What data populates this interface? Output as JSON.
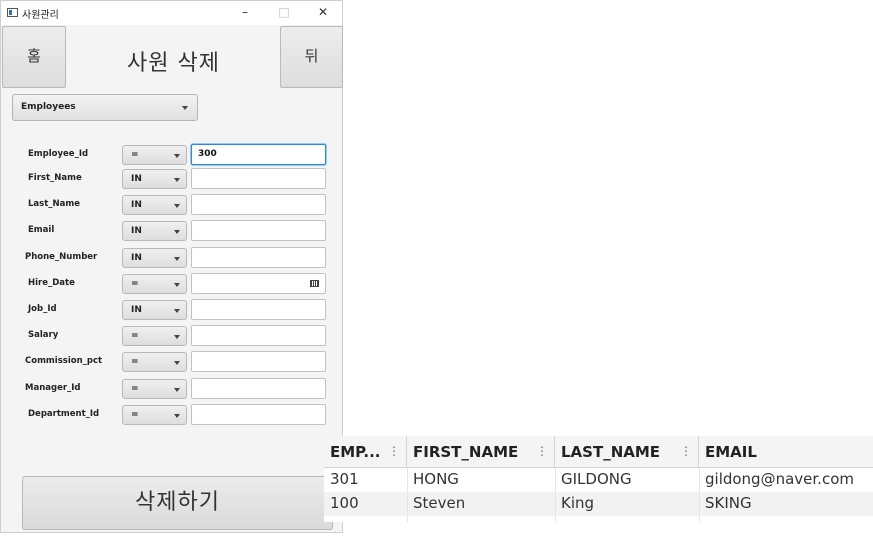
{
  "window": {
    "title": "사원관리",
    "minimize": "–",
    "maximize": "□",
    "close": "✕"
  },
  "nav": {
    "home_label": "홈",
    "back_label": "뒤"
  },
  "page_title": "사원 삭제",
  "table_select": {
    "value": "Employees"
  },
  "fields": [
    {
      "label": "Employee_Id",
      "operator": "=",
      "value": "300"
    },
    {
      "label": "First_Name",
      "operator": "IN",
      "value": ""
    },
    {
      "label": "Last_Name",
      "operator": "IN",
      "value": ""
    },
    {
      "label": "Email",
      "operator": "IN",
      "value": ""
    },
    {
      "label": "Phone_Number",
      "operator": "IN",
      "value": ""
    },
    {
      "label": "Hire_Date",
      "operator": "=",
      "value": ""
    },
    {
      "label": "Job_Id",
      "operator": "IN",
      "value": ""
    },
    {
      "label": "Salary",
      "operator": "=",
      "value": ""
    },
    {
      "label": "Commission_pct",
      "operator": "=",
      "value": ""
    },
    {
      "label": "Manager_Id",
      "operator": "=",
      "value": ""
    },
    {
      "label": "Department_Id",
      "operator": "=",
      "value": ""
    }
  ],
  "delete_button": "삭제하기",
  "results": {
    "columns": [
      "EMP...",
      "FIRST_NAME",
      "LAST_NAME",
      "EMAIL"
    ],
    "column_menu_glyph": "⋮",
    "rows": [
      [
        "301",
        "HONG",
        "GILDONG",
        "gildong@naver.com"
      ],
      [
        "100",
        "Steven",
        "King",
        "SKING"
      ]
    ]
  },
  "icons": {
    "app": "window-app-icon",
    "calendar": "calendar-icon",
    "dropdown": "chevron-down-icon"
  }
}
